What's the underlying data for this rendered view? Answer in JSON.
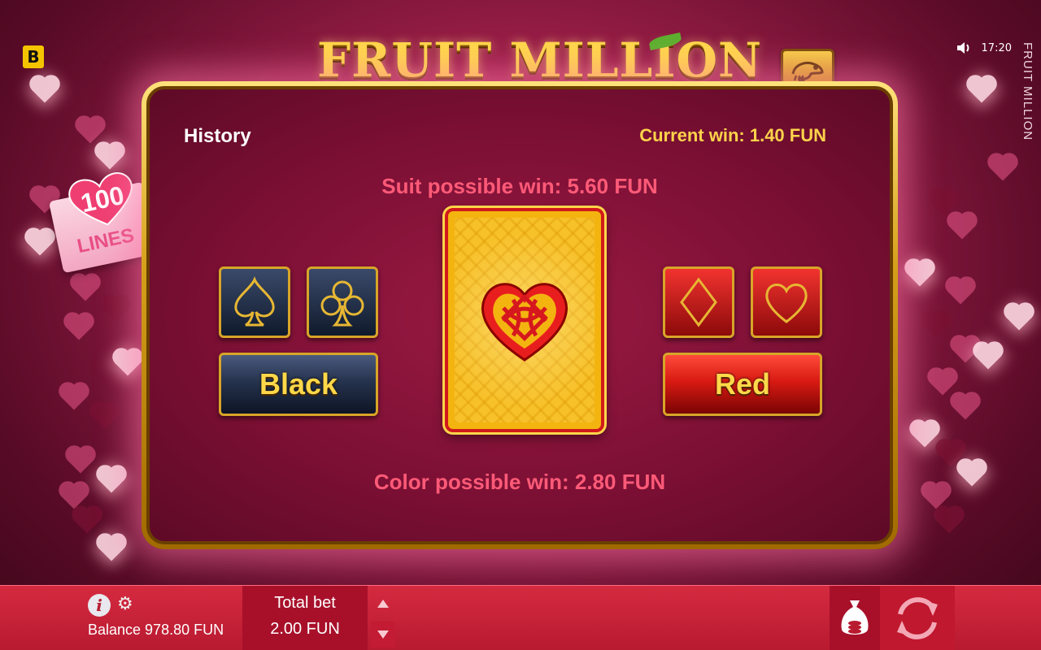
{
  "header": {
    "brand_letter": "B",
    "game_logo": "FRUIT MILLION",
    "vertical_title": "FRUIT MILLION",
    "clock": "17:20",
    "icons": [
      "speaker-icon",
      "chameleon-icon"
    ]
  },
  "lines_badge": {
    "number": "100",
    "word": "LINES"
  },
  "gamble": {
    "history_label": "History",
    "current_win": "Current win: 1.40 FUN",
    "suit_possible_win": "Suit possible win: 5.60 FUN",
    "color_possible_win": "Color possible win: 2.80 FUN",
    "black_button": "Black",
    "red_button": "Red",
    "suits_black": [
      "spade",
      "club"
    ],
    "suits_red": [
      "diamond",
      "heart"
    ]
  },
  "bottom_bar": {
    "balance": "Balance 978.80 FUN",
    "total_bet_label": "Total bet",
    "total_bet_value": "2.00 FUN"
  },
  "colors": {
    "gold": "#ffd84a",
    "win_red": "#ff5a78",
    "bar_red": "#c8203a",
    "panel": "#7a0f33"
  }
}
